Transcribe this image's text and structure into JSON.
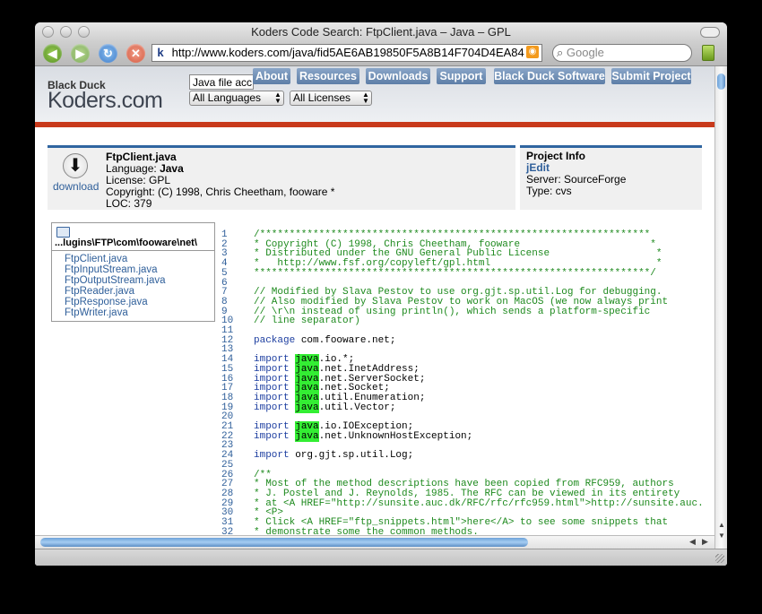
{
  "window": {
    "title": "Koders Code Search: FtpClient.java – Java – GPL"
  },
  "toolbar": {
    "url": "http://www.koders.com/java/fid5AE6AB19850F5A8B14F704D4EA84",
    "site_icon": "k",
    "search_placeholder": "Google",
    "icons": {
      "back": "back-arrow-icon",
      "forward": "forward-arrow-icon",
      "reload": "reload-icon",
      "stop": "stop-icon",
      "rss": "rss-icon",
      "bookmark": "bookmark-icon",
      "search": "magnifier-icon"
    }
  },
  "site": {
    "logo_small": "Black Duck",
    "logo_big": "Koders.com",
    "search_value": "Java file acc",
    "language_select": "All Languages",
    "license_select": "All Licenses",
    "nav": [
      "About",
      "Resources",
      "Downloads",
      "Support",
      "Black Duck Software",
      "Submit Project"
    ]
  },
  "file": {
    "name": "FtpClient.java",
    "download_label": "download",
    "language_label": "Language:",
    "language": "Java",
    "license": "License: GPL",
    "copyright": "Copyright: (C) 1998, Chris Cheetham, fooware *",
    "loc": "LOC: 379"
  },
  "project": {
    "heading": "Project Info",
    "name": "jEdit",
    "server": "Server: SourceForge",
    "type": "Type: cvs"
  },
  "tree": {
    "path": "...lugins\\FTP\\com\\fooware\\net\\",
    "files": [
      "FtpClient.java",
      "FtpInputStream.java",
      "FtpOutputStream.java",
      "FtpReader.java",
      "FtpResponse.java",
      "FtpWriter.java"
    ]
  },
  "code_lines": [
    {
      "n": "1",
      "t": "/******************************************************************",
      "k": "c"
    },
    {
      "n": "2",
      "t": "* Copyright (C) 1998, Chris Cheetham, fooware                      *",
      "k": "c"
    },
    {
      "n": "3",
      "t": "* Distributed under the GNU General Public License                  *",
      "k": "c"
    },
    {
      "n": "4",
      "t": "*   http://www.fsf.org/copyleft/gpl.html                            *",
      "k": "c"
    },
    {
      "n": "5",
      "t": "*******************************************************************/",
      "k": "c"
    },
    {
      "n": "6",
      "t": "",
      "k": "p"
    },
    {
      "n": "7",
      "t": "// Modified by Slava Pestov to use org.gjt.sp.util.Log for debugging.",
      "k": "c"
    },
    {
      "n": "8",
      "t": "// Also modified by Slava Pestov to work on MacOS (we now always print",
      "k": "c"
    },
    {
      "n": "9",
      "t": "// \\r\\n instead of using println(), which sends a platform-specific",
      "k": "c"
    },
    {
      "n": "10",
      "t": "// line separator)",
      "k": "c"
    },
    {
      "n": "11",
      "t": "",
      "k": "p"
    },
    {
      "n": "12",
      "kw": "package",
      "t": " com.fooware.net;",
      "k": "kw"
    },
    {
      "n": "13",
      "t": "",
      "k": "p"
    },
    {
      "n": "14",
      "kw": "import",
      "hl": "java",
      "t": ".io.*;",
      "k": "imp"
    },
    {
      "n": "15",
      "kw": "import",
      "hl": "java",
      "t": ".net.InetAddress;",
      "k": "imp"
    },
    {
      "n": "16",
      "kw": "import",
      "hl": "java",
      "t": ".net.ServerSocket;",
      "k": "imp"
    },
    {
      "n": "17",
      "kw": "import",
      "hl": "java",
      "t": ".net.Socket;",
      "k": "imp"
    },
    {
      "n": "18",
      "kw": "import",
      "hl": "java",
      "t": ".util.Enumeration;",
      "k": "imp"
    },
    {
      "n": "19",
      "kw": "import",
      "hl": "java",
      "t": ".util.Vector;",
      "k": "imp"
    },
    {
      "n": "20",
      "t": "",
      "k": "p"
    },
    {
      "n": "21",
      "kw": "import",
      "hl": "java",
      "t": ".io.IOException;",
      "k": "imp"
    },
    {
      "n": "22",
      "kw": "import",
      "hl": "java",
      "t": ".net.UnknownHostException;",
      "k": "imp"
    },
    {
      "n": "23",
      "t": "",
      "k": "p"
    },
    {
      "n": "24",
      "kw": "import",
      "t": " org.gjt.sp.util.Log;",
      "k": "kw"
    },
    {
      "n": "25",
      "t": "",
      "k": "p"
    },
    {
      "n": "26",
      "t": "/**",
      "k": "c"
    },
    {
      "n": "27",
      "t": "* Most of the method descriptions have been copied from RFC959, authors",
      "k": "c"
    },
    {
      "n": "28",
      "t": "* J. Postel and J. Reynolds, 1985. The RFC can be viewed in its entirety",
      "k": "c"
    },
    {
      "n": "29",
      "t": "* at <A HREF=\"http://sunsite.auc.dk/RFC/rfc/rfc959.html\">http://sunsite.auc.",
      "k": "c"
    },
    {
      "n": "30",
      "t": "* <P>",
      "k": "c"
    },
    {
      "n": "31",
      "t": "* Click <A HREF=\"ftp_snippets.html\">here</A> to see some snippets that",
      "k": "c"
    },
    {
      "n": "32",
      "t": "* demonstrate some the common methods.",
      "k": "c"
    }
  ]
}
